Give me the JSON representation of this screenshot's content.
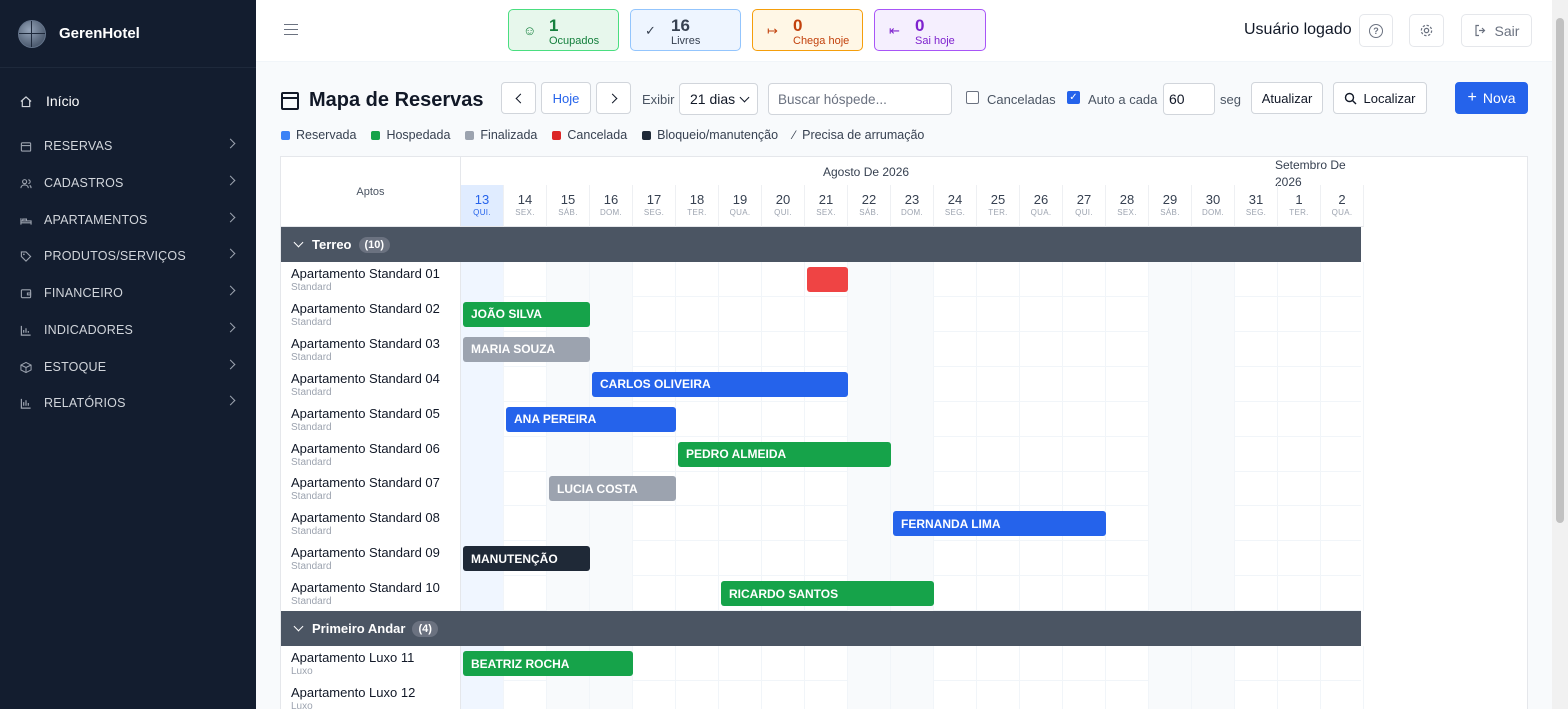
{
  "app": {
    "name": "GerenHotel"
  },
  "sidebar": {
    "home_label": "Início",
    "items": [
      {
        "label": "RESERVAS",
        "icon": "calendar-icon"
      },
      {
        "label": "CADASTROS",
        "icon": "users-icon"
      },
      {
        "label": "APARTAMENTOS",
        "icon": "bed-icon"
      },
      {
        "label": "PRODUTOS/SERVIÇOS",
        "icon": "tag-icon"
      },
      {
        "label": "FINANCEIRO",
        "icon": "wallet-icon"
      },
      {
        "label": "INDICADORES",
        "icon": "bar-chart-icon"
      },
      {
        "label": "ESTOQUE",
        "icon": "box-icon"
      },
      {
        "label": "RELATÓRIOS",
        "icon": "report-icon"
      }
    ]
  },
  "topbar": {
    "stats": [
      {
        "value": "1",
        "label": "Ocupados",
        "icon": "user-icon",
        "color": "#15803d",
        "bg": "#e7f7ec",
        "border": "#4ade80"
      },
      {
        "value": "16",
        "label": "Livres",
        "icon": "check-icon",
        "color": "#374151",
        "bg": "#eef5ff",
        "border": "#93c5fd"
      },
      {
        "value": "0",
        "label": "Chega hoje",
        "icon": "login-icon",
        "color": "#c2410c",
        "bg": "#fff7e6",
        "border": "#f59e0b"
      },
      {
        "value": "0",
        "label": "Sai hoje",
        "icon": "logout-icon",
        "color": "#7e22ce",
        "bg": "#f5effe",
        "border": "#a855f7"
      }
    ],
    "user_label": "Usuário logado",
    "logout_label": "Sair"
  },
  "toolbar": {
    "title": "Mapa de Reservas",
    "today_label": "Hoje",
    "show_label": "Exibir",
    "range_value": "21 dias",
    "search_placeholder": "Buscar hóspede...",
    "cancelled_label": "Canceladas",
    "cancelled_checked": false,
    "auto_label": "Auto a cada",
    "auto_checked": true,
    "auto_value": "60",
    "auto_unit": "seg",
    "refresh_label": "Atualizar",
    "locate_label": "Localizar",
    "new_label": "Nova"
  },
  "legend": [
    {
      "label": "Reservada",
      "color": "#3b82f6"
    },
    {
      "label": "Hospedada",
      "color": "#16a34a"
    },
    {
      "label": "Finalizada",
      "color": "#9ca3af"
    },
    {
      "label": "Cancelada",
      "color": "#dc2626"
    },
    {
      "label": "Bloqueio/manutenção",
      "color": "#1f2937"
    },
    {
      "label": "Precisa de arrumação",
      "color": "",
      "icon": "broom-icon"
    }
  ],
  "grid": {
    "aptos_label": "Aptos",
    "month_aug": "Agosto De 2026",
    "month_sep_1": "Setembro De",
    "month_sep_2": "2026",
    "days": [
      {
        "d": "13",
        "w": "QUI."
      },
      {
        "d": "14",
        "w": "SEX."
      },
      {
        "d": "15",
        "w": "SÁB."
      },
      {
        "d": "16",
        "w": "DOM."
      },
      {
        "d": "17",
        "w": "SEG."
      },
      {
        "d": "18",
        "w": "TER."
      },
      {
        "d": "19",
        "w": "QUA."
      },
      {
        "d": "20",
        "w": "QUI."
      },
      {
        "d": "21",
        "w": "SEX."
      },
      {
        "d": "22",
        "w": "SÁB."
      },
      {
        "d": "23",
        "w": "DOM."
      },
      {
        "d": "24",
        "w": "SEG."
      },
      {
        "d": "25",
        "w": "TER."
      },
      {
        "d": "26",
        "w": "QUA."
      },
      {
        "d": "27",
        "w": "QUI."
      },
      {
        "d": "28",
        "w": "SEX."
      },
      {
        "d": "29",
        "w": "SÁB."
      },
      {
        "d": "30",
        "w": "DOM."
      },
      {
        "d": "31",
        "w": "SEG."
      },
      {
        "d": "1",
        "w": "TER."
      },
      {
        "d": "2",
        "w": "QUA."
      }
    ],
    "groups": [
      {
        "name": "Terreo",
        "count": "(10)",
        "rooms": [
          {
            "name": "Apartamento Standard 01",
            "type": "Standard",
            "booking": {
              "guest": "",
              "start": 8,
              "days": 1,
              "color": "#ef4444"
            }
          },
          {
            "name": "Apartamento Standard 02",
            "type": "Standard",
            "booking": {
              "guest": "JOÃO SILVA",
              "start": 0,
              "days": 3,
              "color": "#16a34a"
            }
          },
          {
            "name": "Apartamento Standard 03",
            "type": "Standard",
            "booking": {
              "guest": "MARIA SOUZA",
              "start": 0,
              "days": 3,
              "color": "#9ca3af"
            }
          },
          {
            "name": "Apartamento Standard 04",
            "type": "Standard",
            "booking": {
              "guest": "CARLOS OLIVEIRA",
              "start": 3,
              "days": 6,
              "color": "#2563eb"
            }
          },
          {
            "name": "Apartamento Standard 05",
            "type": "Standard",
            "booking": {
              "guest": "ANA PEREIRA",
              "start": 1,
              "days": 4,
              "color": "#2563eb"
            }
          },
          {
            "name": "Apartamento Standard 06",
            "type": "Standard",
            "booking": {
              "guest": "PEDRO ALMEIDA",
              "start": 5,
              "days": 5,
              "color": "#16a34a"
            }
          },
          {
            "name": "Apartamento Standard 07",
            "type": "Standard",
            "booking": {
              "guest": "LUCIA COSTA",
              "start": 2,
              "days": 3,
              "color": "#9ca3af"
            }
          },
          {
            "name": "Apartamento Standard 08",
            "type": "Standard",
            "booking": {
              "guest": "FERNANDA LIMA",
              "start": 10,
              "days": 5,
              "color": "#2563eb"
            }
          },
          {
            "name": "Apartamento Standard 09",
            "type": "Standard",
            "booking": {
              "guest": "MANUTENÇÃO",
              "start": 0,
              "days": 3,
              "color": "#1f2937"
            }
          },
          {
            "name": "Apartamento Standard 10",
            "type": "Standard",
            "booking": {
              "guest": "RICARDO SANTOS",
              "start": 6,
              "days": 5,
              "color": "#16a34a"
            }
          }
        ]
      },
      {
        "name": "Primeiro Andar",
        "count": "(4)",
        "rooms": [
          {
            "name": "Apartamento Luxo 11",
            "type": "Luxo",
            "booking": {
              "guest": "BEATRIZ ROCHA",
              "start": 0,
              "days": 4,
              "color": "#16a34a"
            }
          },
          {
            "name": "Apartamento Luxo 12",
            "type": "Luxo",
            "booking": null
          }
        ]
      }
    ]
  }
}
